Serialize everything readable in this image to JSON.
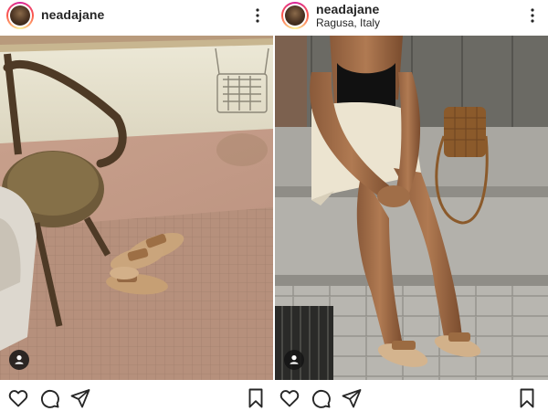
{
  "posts": [
    {
      "username": "neadajane",
      "location": "",
      "icons": {
        "more": "more-vertical-icon",
        "tag": "user-tag-icon",
        "like": "heart-icon",
        "comment": "comment-icon",
        "share": "send-icon",
        "save": "bookmark-icon"
      }
    },
    {
      "username": "neadajane",
      "location": "Ragusa, Italy",
      "icons": {
        "more": "more-vertical-icon",
        "tag": "user-tag-icon",
        "like": "heart-icon",
        "comment": "comment-icon",
        "share": "send-icon",
        "save": "bookmark-icon"
      }
    }
  ],
  "colors": {
    "text": "#262626",
    "divider": "#dbdbdb"
  }
}
